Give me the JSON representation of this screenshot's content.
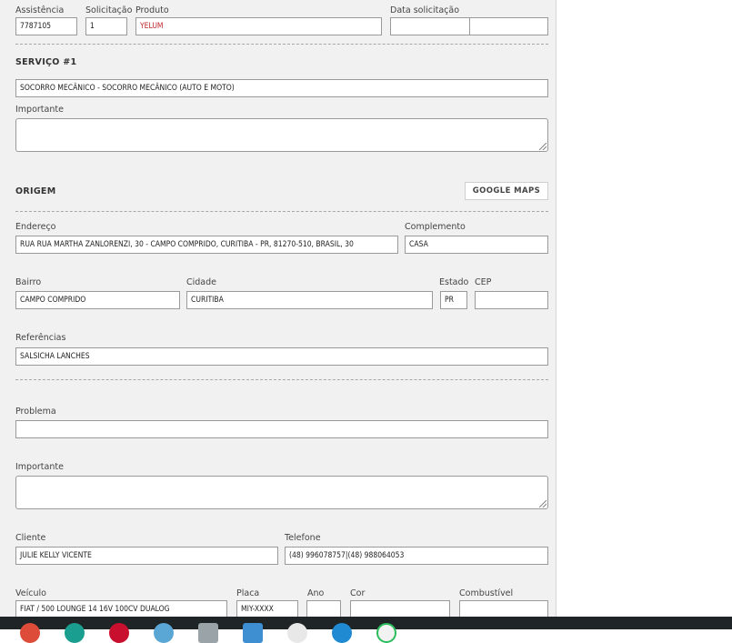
{
  "header": {
    "assistencia_label": "Assistência",
    "assistencia_value": "7787105",
    "solicitacao_label": "Solicitação",
    "solicitacao_value": "1",
    "produto_label": "Produto",
    "produto_value": "YELUM",
    "data_label": "Data solicitação",
    "data_value": "",
    "hora_value": ""
  },
  "servico": {
    "title": "SERVIÇO #1",
    "value": "SOCORRO MECÂNICO - SOCORRO MECÂNICO (AUTO E MOTO)",
    "importante_label": "Importante",
    "importante_value": ""
  },
  "origem": {
    "title": "ORIGEM",
    "maps_button": "GOOGLE MAPS",
    "endereco_label": "Endereço",
    "endereco_value": "RUA RUA MARTHA ZANLORENZI, 30 - CAMPO COMPRIDO, CURITIBA - PR, 81270-510, BRASIL, 30",
    "complemento_label": "Complemento",
    "complemento_value": "CASA",
    "bairro_label": "Bairro",
    "bairro_value": "CAMPO COMPRIDO",
    "cidade_label": "Cidade",
    "cidade_value": "CURITIBA",
    "estado_label": "Estado",
    "estado_value": "PR",
    "cep_label": "CEP",
    "cep_value": "",
    "referencias_label": "Referências",
    "referencias_value": "SALSICHA LANCHES"
  },
  "detalhes": {
    "problema_label": "Problema",
    "problema_value": "",
    "importante_label": "Importante",
    "importante_value": "",
    "cliente_label": "Cliente",
    "cliente_value": "JULIE KELLY VICENTE",
    "telefone_label": "Telefone",
    "telefone_value": "(48) 996078757|(48) 988064053",
    "veiculo_label": "Veículo",
    "veiculo_value": "FIAT / 500 LOUNGE 14 16V 100CV DUALOG",
    "placa_label": "Placa",
    "placa_value": "MIY-XXXX",
    "ano_label": "Ano",
    "ano_value": "",
    "cor_label": "Cor",
    "cor_value": "",
    "combustivel_label": "Combustível",
    "combustivel_value": ""
  },
  "taskbar": {
    "icons": [
      "chrome-icon",
      "edge-icon",
      "opera-icon",
      "browser-icon",
      "files-icon",
      "calculator-icon",
      "chrome-profile-icon",
      "app-icon",
      "whatsapp-icon"
    ]
  },
  "colors": {
    "panel_bg": "#f1f1f1",
    "produto_text": "#c0282d",
    "taskbar_bg": "#1f2427"
  }
}
